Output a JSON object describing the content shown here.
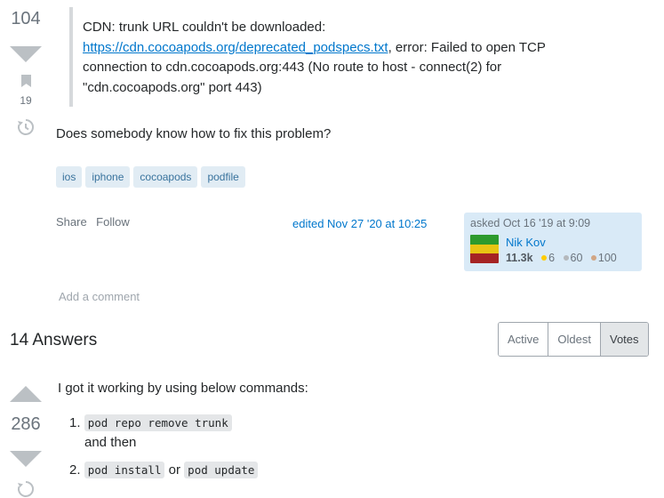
{
  "question": {
    "votes": "104",
    "bookmarks": "19",
    "quote": {
      "line1": "CDN: trunk URL couldn't be downloaded:",
      "link": "https://cdn.cocoapods.org/deprecated_podspecs.txt",
      "after_link": ", error: Failed to open TCP",
      "line3": "connection to cdn.cocoapods.org:443 (No route to host - connect(2) for",
      "line4": "\"cdn.cocoapods.org\" port 443)"
    },
    "body": "Does somebody know how to fix this problem?",
    "tags": [
      "ios",
      "iphone",
      "cocoapods",
      "podfile"
    ],
    "menu": {
      "share": "Share",
      "follow": "Follow"
    },
    "edited": "edited Nov 27 '20 at 10:25",
    "asker": {
      "asked": "asked Oct 16 '19 at 9:09",
      "name": "Nik Kov",
      "reputation": "11.3k",
      "gold": "6",
      "silver": "60",
      "bronze": "100"
    },
    "add_comment": "Add a comment"
  },
  "answers": {
    "header": "14 Answers",
    "sort": [
      "Active",
      "Oldest",
      "Votes"
    ],
    "sort_selected": "Votes",
    "top": {
      "votes": "286",
      "intro": "I got it working by using below commands:",
      "step1_num": "1.",
      "step1_code": "pod repo remove trunk",
      "step1_after": "and then",
      "step2_num": "2.",
      "step2_code1": "pod install",
      "step2_or": "or",
      "step2_code2": "pod update"
    }
  },
  "colors": {
    "link": "#0077cc",
    "tag_bg": "#e1ecf4",
    "tag_text": "#39739d",
    "user_card_bg": "#d9eaf7",
    "gold": "#ffcc01",
    "silver": "#b4b8bc",
    "bronze": "#d1a684"
  },
  "icons": [
    "vote-down-icon",
    "bookmark-icon",
    "history-icon",
    "vote-up-icon"
  ]
}
